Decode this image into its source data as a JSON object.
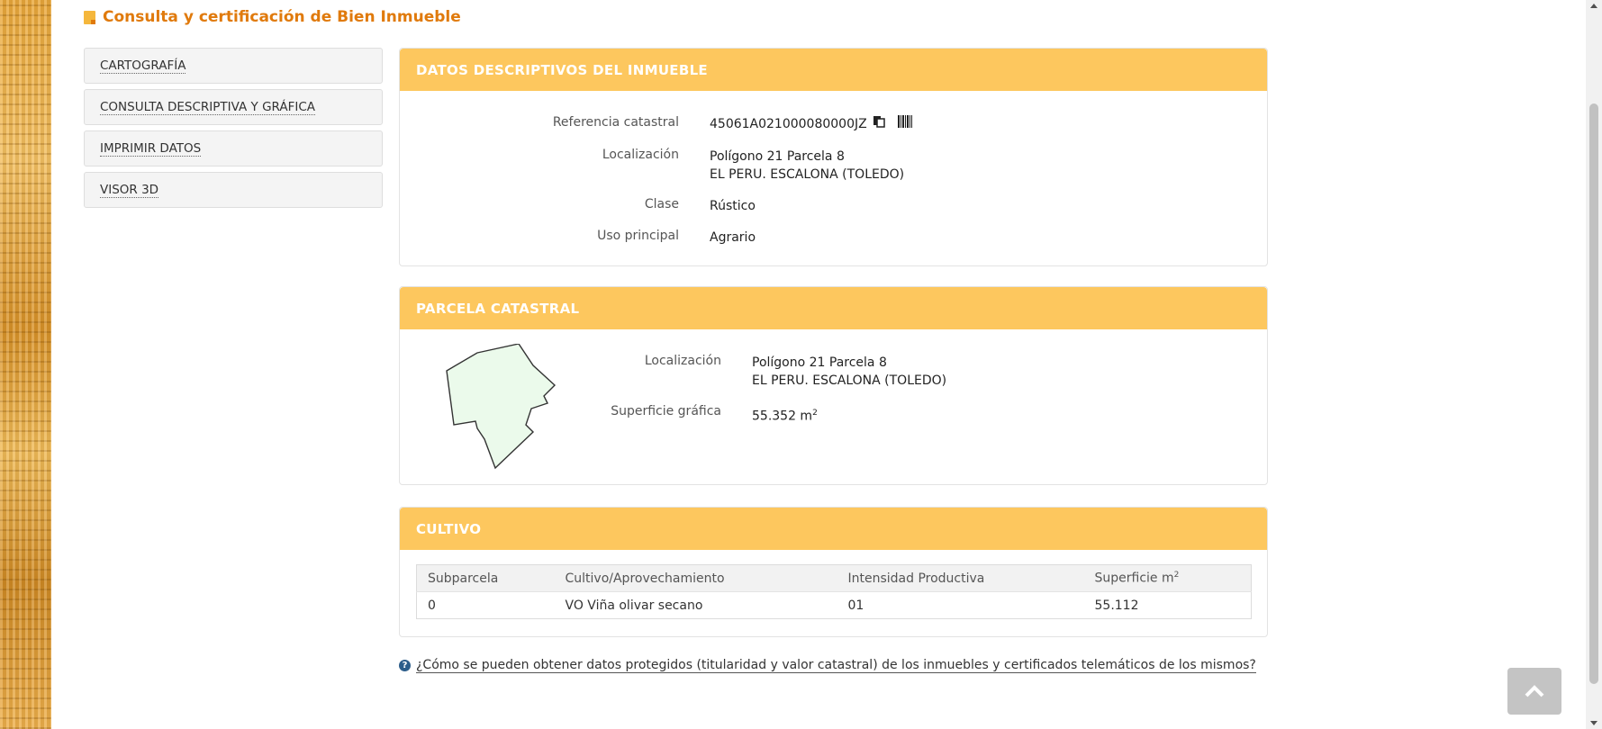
{
  "page_title": "Consulta y certificación de Bien Inmueble",
  "side_menu": [
    {
      "label": "CARTOGRAFÍA"
    },
    {
      "label": "CONSULTA DESCRIPTIVA Y GRÁFICA"
    },
    {
      "label": "IMPRIMIR DATOS"
    },
    {
      "label": "VISOR 3D"
    }
  ],
  "datos": {
    "header": "DATOS DESCRIPTIVOS DEL INMUEBLE",
    "ref_label": "Referencia catastral",
    "ref_value": "45061A021000080000JZ",
    "loc_label": "Localización",
    "loc_line1": "Polígono 21 Parcela 8",
    "loc_line2": "EL PERU. ESCALONA (TOLEDO)",
    "clase_label": "Clase",
    "clase_value": "Rústico",
    "uso_label": "Uso principal",
    "uso_value": "Agrario"
  },
  "parcela": {
    "header": "PARCELA CATASTRAL",
    "loc_label": "Localización",
    "loc_line1": "Polígono 21 Parcela 8",
    "loc_line2": "EL PERU. ESCALONA (TOLEDO)",
    "sup_label": "Superficie gráfica",
    "sup_value": "55.352 m",
    "sup_unit_sup": "2",
    "shape_fill": "#ebfaeb",
    "shape_stroke": "#333333"
  },
  "cultivo": {
    "header": "CULTIVO",
    "columns": [
      "Subparcela",
      "Cultivo/Aprovechamiento",
      "Intensidad Productiva",
      "Superficie m"
    ],
    "col4_sup": "2",
    "rows": [
      [
        "0",
        "VO Viña olivar secano",
        "01",
        "55.112"
      ]
    ]
  },
  "help": {
    "text": "¿Cómo se pueden obtener datos protegidos (titularidad y valor catastral) de los inmuebles y certificados telemáticos de los mismos?"
  },
  "colors": {
    "accent": "#fdc75e",
    "title": "#e07a0c"
  },
  "icons": {
    "copy": "copy-icon",
    "barcode": "barcode-icon",
    "help": "question-circle-icon",
    "scroll_top": "chevron-up-icon"
  }
}
